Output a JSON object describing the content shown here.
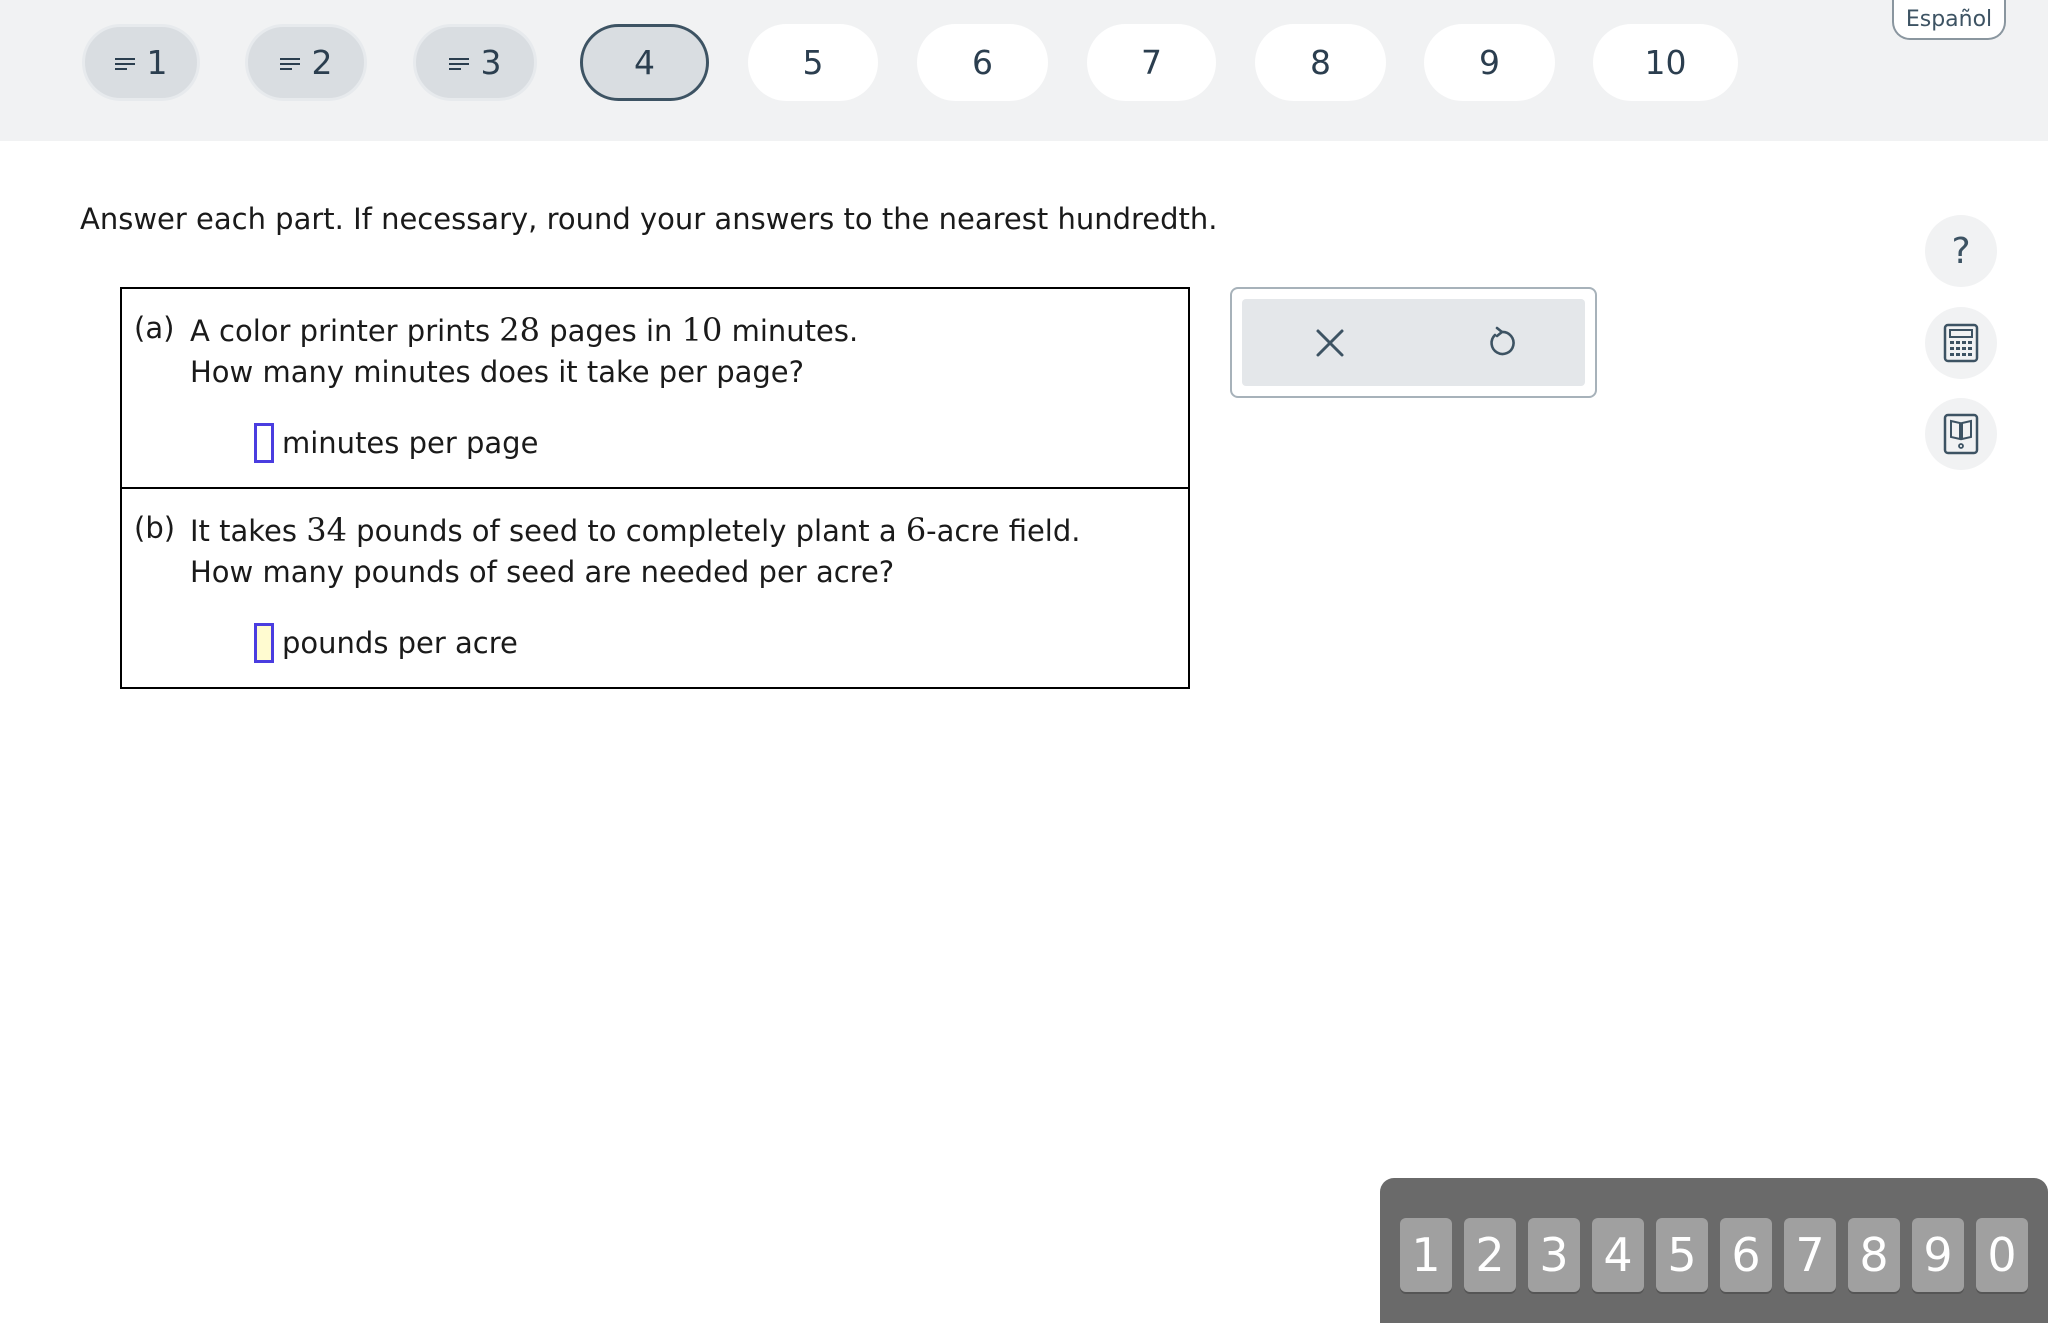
{
  "nav": {
    "questions": [
      {
        "label": "1",
        "state": "answered"
      },
      {
        "label": "2",
        "state": "answered"
      },
      {
        "label": "3",
        "state": "answered"
      },
      {
        "label": "4",
        "state": "current"
      },
      {
        "label": "5",
        "state": "unanswered"
      },
      {
        "label": "6",
        "state": "unanswered"
      },
      {
        "label": "7",
        "state": "unanswered"
      },
      {
        "label": "8",
        "state": "unanswered"
      },
      {
        "label": "9",
        "state": "unanswered"
      },
      {
        "label": "10",
        "state": "unanswered"
      }
    ],
    "language_link": "Español"
  },
  "instructions": "Answer each part. If necessary, round your answers to the nearest hundredth.",
  "parts": {
    "a": {
      "label": "(a)",
      "text_pre": "A color printer prints ",
      "num1": "28",
      "text_mid": " pages in ",
      "num2": "10",
      "text_post": " minutes.",
      "question": "How many minutes does it take per page?",
      "answer_value": "",
      "unit": "minutes per page"
    },
    "b": {
      "label": "(b)",
      "text_pre": "It takes ",
      "num1": "34",
      "text_mid": " pounds of seed to completely plant a ",
      "num2": "6",
      "text_post": "-acre field.",
      "question": "How many pounds of seed are needed per acre?",
      "answer_value": "",
      "unit": "pounds per acre"
    }
  },
  "tools": {
    "clear_icon": "close-icon",
    "undo_icon": "undo-icon"
  },
  "sidebar": {
    "help_label": "?",
    "calculator_icon": "calculator-icon",
    "ebook_icon": "book-icon"
  },
  "keypad": {
    "keys": [
      "1",
      "2",
      "3",
      "4",
      "5",
      "6",
      "7",
      "8",
      "9",
      "0"
    ]
  },
  "colors": {
    "accent": "#3d5363",
    "answer_box_border": "#4a3de0",
    "answer_box_active": "#fffbd0",
    "keypad_bg": "#6a6a6a",
    "key_bg": "#a0a0a0"
  }
}
